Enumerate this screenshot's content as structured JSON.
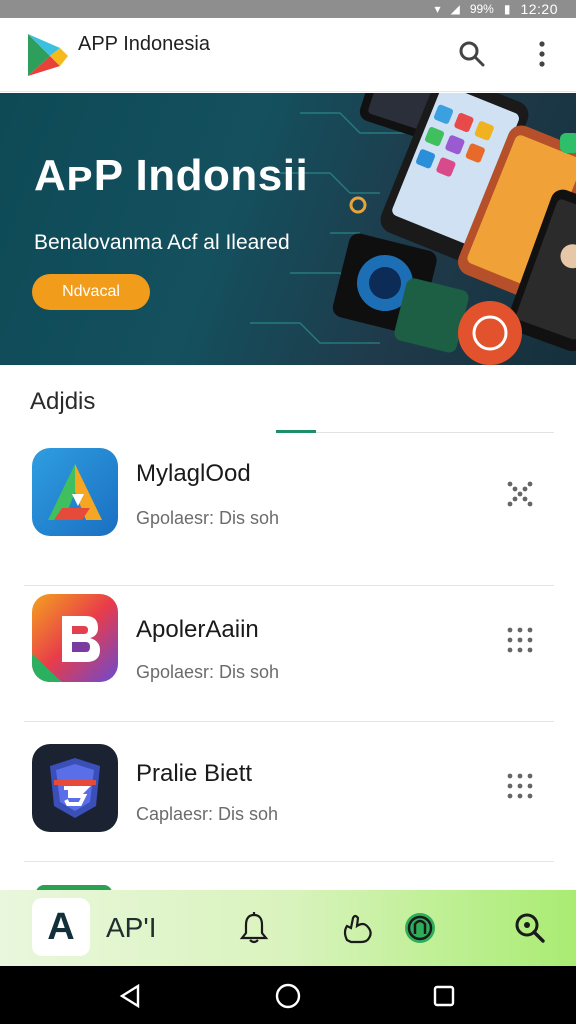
{
  "status_bar": {
    "battery": "99%",
    "time": "12:20"
  },
  "app_bar": {
    "title": "APP Indonesia",
    "search_icon": "search-icon",
    "more_icon": "more-vert-icon"
  },
  "banner": {
    "title": "AᴘP Indonsii",
    "subtitle": "Benalovanma Aᴄf al Ileared",
    "cta_label": "Ndvacal"
  },
  "section": {
    "title": "Adjdis"
  },
  "apps": [
    {
      "name": "MylaglOod",
      "developer": "Gpolaesr: Dis soh",
      "menu_icon": "shuffle-dots-icon",
      "icon": "gradient-a-logo"
    },
    {
      "name": "ApolerAaiin",
      "developer": "Gpolaesr: Dis soh",
      "menu_icon": "grid-dots-icon",
      "icon": "gradient-b-logo"
    },
    {
      "name": "Pralie Biett",
      "developer": "Caplaesr: Dis soh",
      "menu_icon": "grid-dots-icon",
      "icon": "shield-3-logo"
    }
  ],
  "bottom_nav": {
    "home_letter": "A",
    "label": "AP'I",
    "items": [
      "bell-icon",
      "hand-icon",
      "badge-icon",
      "search-icon"
    ]
  },
  "system_nav": [
    "back-icon",
    "home-icon",
    "recents-icon"
  ],
  "colors": {
    "accent": "#1d8f66",
    "cta": "#f29c1c",
    "banner_bg": "#0d4a56"
  }
}
